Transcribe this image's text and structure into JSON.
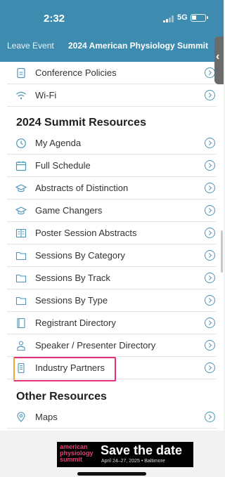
{
  "status_bar": {
    "time": "2:32",
    "network": "5G"
  },
  "header": {
    "leave_label": "Leave Event",
    "event_title": "2024 American Physiology Summit"
  },
  "top_items": [
    {
      "label": "Conference Policies",
      "icon": "document-icon"
    },
    {
      "label": "Wi-Fi",
      "icon": "wifi-icon"
    }
  ],
  "sections": {
    "summit_resources": "2024 Summit Resources",
    "other_resources": "Other Resources"
  },
  "summit_items": [
    {
      "label": "My Agenda",
      "icon": "clock-icon"
    },
    {
      "label": "Full Schedule",
      "icon": "calendar-icon"
    },
    {
      "label": "Abstracts of Distinction",
      "icon": "graduation-cap-icon"
    },
    {
      "label": "Game Changers",
      "icon": "graduation-cap-icon"
    },
    {
      "label": "Poster Session Abstracts",
      "icon": "book-icon"
    },
    {
      "label": "Sessions By Category",
      "icon": "folder-icon"
    },
    {
      "label": "Sessions By Track",
      "icon": "folder-icon"
    },
    {
      "label": "Sessions By Type",
      "icon": "folder-icon"
    },
    {
      "label": "Registrant Directory",
      "icon": "address-book-icon"
    },
    {
      "label": "Speaker / Presenter Directory",
      "icon": "person-icon"
    },
    {
      "label": "Industry Partners",
      "icon": "building-icon",
      "highlighted": true
    }
  ],
  "other_items": [
    {
      "label": "Maps",
      "icon": "map-pin-icon"
    }
  ],
  "banner": {
    "brand_line1": "american",
    "brand_line2": "physiology",
    "brand_line3": "summit",
    "headline": "Save the date",
    "subline": "April 24–27, 2025 • Baltimore"
  },
  "colors": {
    "header": "#3d8cb0",
    "accent": "#4b95b8",
    "highlight": "#e3307a"
  }
}
